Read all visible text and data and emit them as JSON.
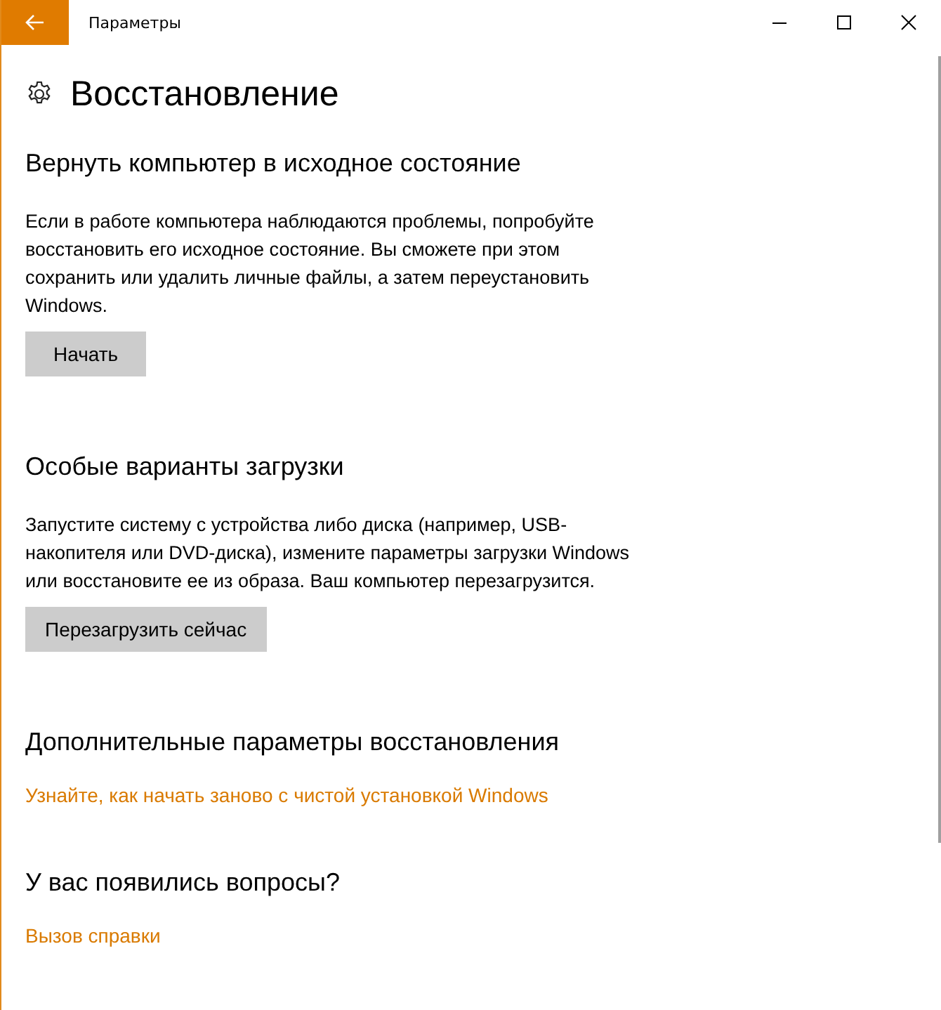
{
  "window": {
    "title": "Параметры"
  },
  "page": {
    "title": "Восстановление"
  },
  "sections": [
    {
      "title": "Вернуть компьютер в исходное состояние",
      "text": "Если в работе компьютера наблюдаются проблемы, попробуйте восстановить его исходное состояние. Вы сможете при этом сохранить или удалить личные файлы, а затем переустановить Windows.",
      "button": "Начать"
    },
    {
      "title": "Особые варианты загрузки",
      "text": "Запустите систему с устройства либо диска (например, USB-накопителя или DVD-диска), измените параметры загрузки Windows или восстановите ее из образа. Ваш компьютер перезагрузится.",
      "button": "Перезагрузить сейчас"
    },
    {
      "title": "Дополнительные параметры восстановления",
      "link": "Узнайте, как начать заново с чистой установкой Windows"
    },
    {
      "title": "У вас появились вопросы?",
      "link": "Вызов справки"
    }
  ]
}
